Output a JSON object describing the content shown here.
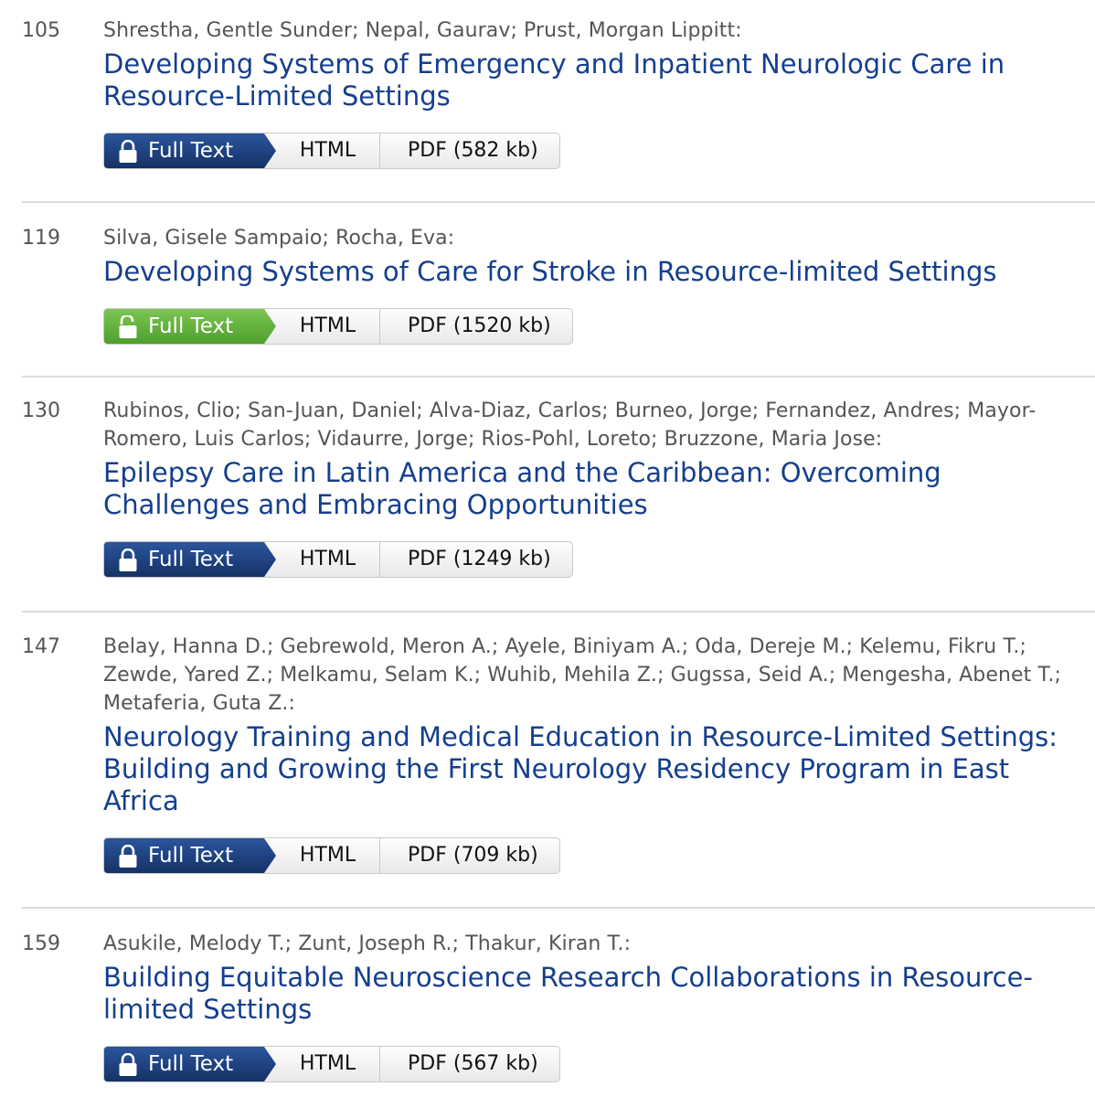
{
  "colors": {
    "title_link": "#153f8c",
    "locked_button": "#1b3f80",
    "open_access_button": "#66b43f",
    "separator": "#dcdcdc"
  },
  "labels": {
    "full_text": "Full Text",
    "html": "HTML"
  },
  "articles": [
    {
      "page": "105",
      "authors": "Shrestha, Gentle Sunder; Nepal, Gaurav; Prust, Morgan Lippitt:",
      "title": "Developing Systems of Emergency and Inpatient Neurologic Care in Resource-Limited Settings",
      "access": "locked",
      "lock_icon": "lock-closed-icon",
      "pdf": "PDF (582 kb)"
    },
    {
      "page": "119",
      "authors": "Silva, Gisele Sampaio; Rocha, Eva:",
      "title": "Developing Systems of Care for Stroke in Resource-limited Settings",
      "access": "open",
      "lock_icon": "lock-open-icon",
      "pdf": "PDF (1520 kb)"
    },
    {
      "page": "130",
      "authors": "Rubinos, Clio; San-Juan, Daniel; Alva-Diaz, Carlos; Burneo, Jorge; Fernandez, Andres; Mayor-Romero, Luis Carlos; Vidaurre, Jorge; Rios-Pohl, Loreto; Bruzzone, Maria Jose:",
      "title": "Epilepsy Care in Latin America and the Caribbean: Overcoming Challenges and Embracing Opportunities",
      "access": "locked",
      "lock_icon": "lock-closed-icon",
      "pdf": "PDF (1249 kb)"
    },
    {
      "page": "147",
      "authors": "Belay, Hanna D.; Gebrewold, Meron A.; Ayele, Biniyam A.; Oda, Dereje M.; Kelemu, Fikru T.; Zewde, Yared Z.; Melkamu, Selam K.; Wuhib, Mehila Z.; Gugssa, Seid A.; Mengesha, Abenet T.; Metaferia, Guta Z.:",
      "title": "Neurology Training and Medical Education in Resource-Limited Settings: Building and Growing the First Neurology Residency Program in East Africa",
      "access": "locked",
      "lock_icon": "lock-closed-icon",
      "pdf": "PDF (709 kb)"
    },
    {
      "page": "159",
      "authors": "Asukile, Melody T.; Zunt, Joseph R.; Thakur, Kiran T.:",
      "title": "Building Equitable Neuroscience Research Collaborations in Resource-limited Settings",
      "access": "locked",
      "lock_icon": "lock-closed-icon",
      "pdf": "PDF (567 kb)"
    }
  ]
}
